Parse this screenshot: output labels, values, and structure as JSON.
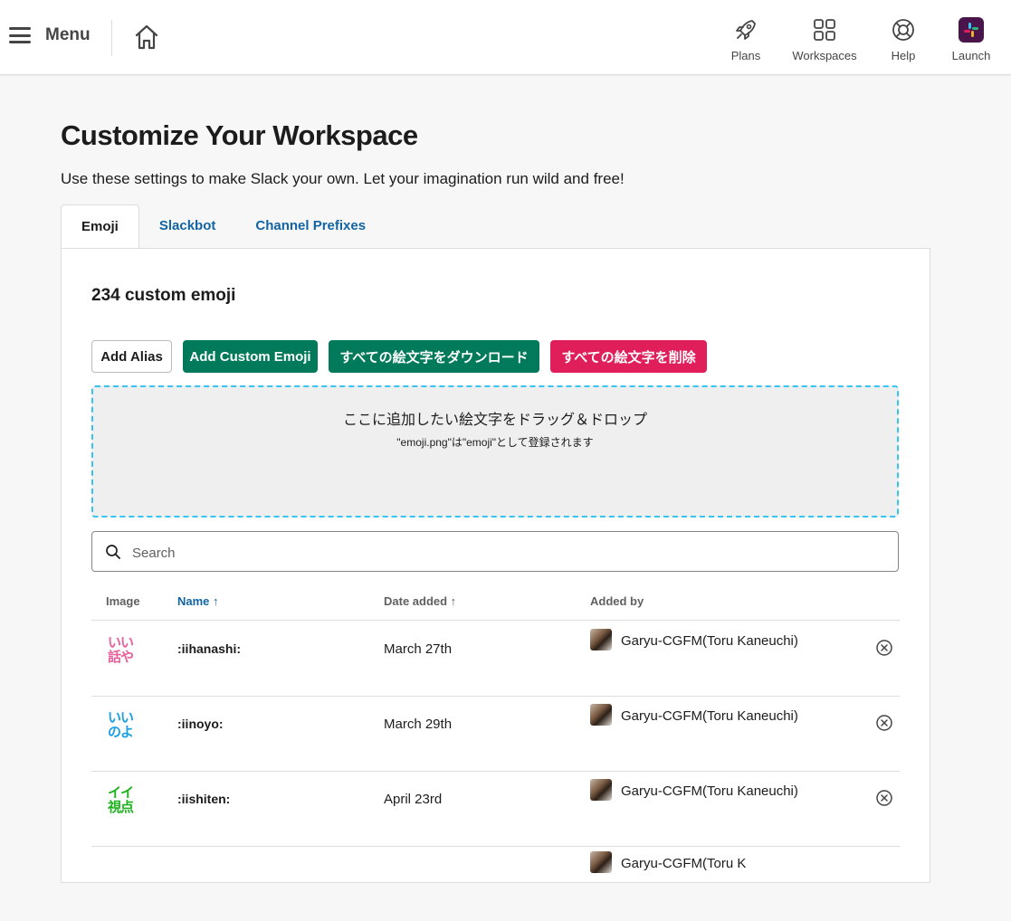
{
  "topbar": {
    "menu_label": "Menu",
    "nav": {
      "plans": "Plans",
      "workspaces": "Workspaces",
      "help": "Help",
      "launch": "Launch"
    }
  },
  "page": {
    "title": "Customize Your Workspace",
    "subtitle": "Use these settings to make Slack your own. Let your imagination run wild and free!"
  },
  "tabs": [
    {
      "label": "Emoji",
      "active": true
    },
    {
      "label": "Slackbot",
      "active": false
    },
    {
      "label": "Channel Prefixes",
      "active": false
    }
  ],
  "emoji_panel": {
    "count_label": "234 custom emoji",
    "buttons": {
      "add_alias": "Add Alias",
      "add_custom": "Add Custom Emoji",
      "download_all": "すべての絵文字をダウンロード",
      "delete_all": "すべての絵文字を削除"
    },
    "dropzone": {
      "main": "ここに追加したい絵文字をドラッグ＆ドロップ",
      "sub": "\"emoji.png\"は\"emoji\"として登録されます"
    },
    "search": {
      "placeholder": "Search",
      "value": ""
    },
    "table": {
      "headers": {
        "image": "Image",
        "name": "Name ↑",
        "date": "Date added ↑",
        "added_by": "Added by"
      },
      "rows": [
        {
          "image_lines": [
            "いい",
            "話や"
          ],
          "image_color": "#e8609a",
          "name": ":iihanashi:",
          "date": "March 27th",
          "added_by": "Garyu-CGFM(Toru Kaneuchi)"
        },
        {
          "image_lines": [
            "いい",
            "のよ"
          ],
          "image_color": "#1aa0e6",
          "name": ":iinoyo:",
          "date": "March 29th",
          "added_by": "Garyu-CGFM(Toru Kaneuchi)"
        },
        {
          "image_lines": [
            "イイ",
            "視点"
          ],
          "image_color": "#1eb21e",
          "name": ":iishiten:",
          "date": "April 23rd",
          "added_by": "Garyu-CGFM(Toru Kaneuchi)"
        },
        {
          "image_lines": [
            "",
            ""
          ],
          "image_color": "#888888",
          "name": "",
          "date": "",
          "added_by": "Garyu-CGFM(Toru K"
        }
      ]
    }
  }
}
